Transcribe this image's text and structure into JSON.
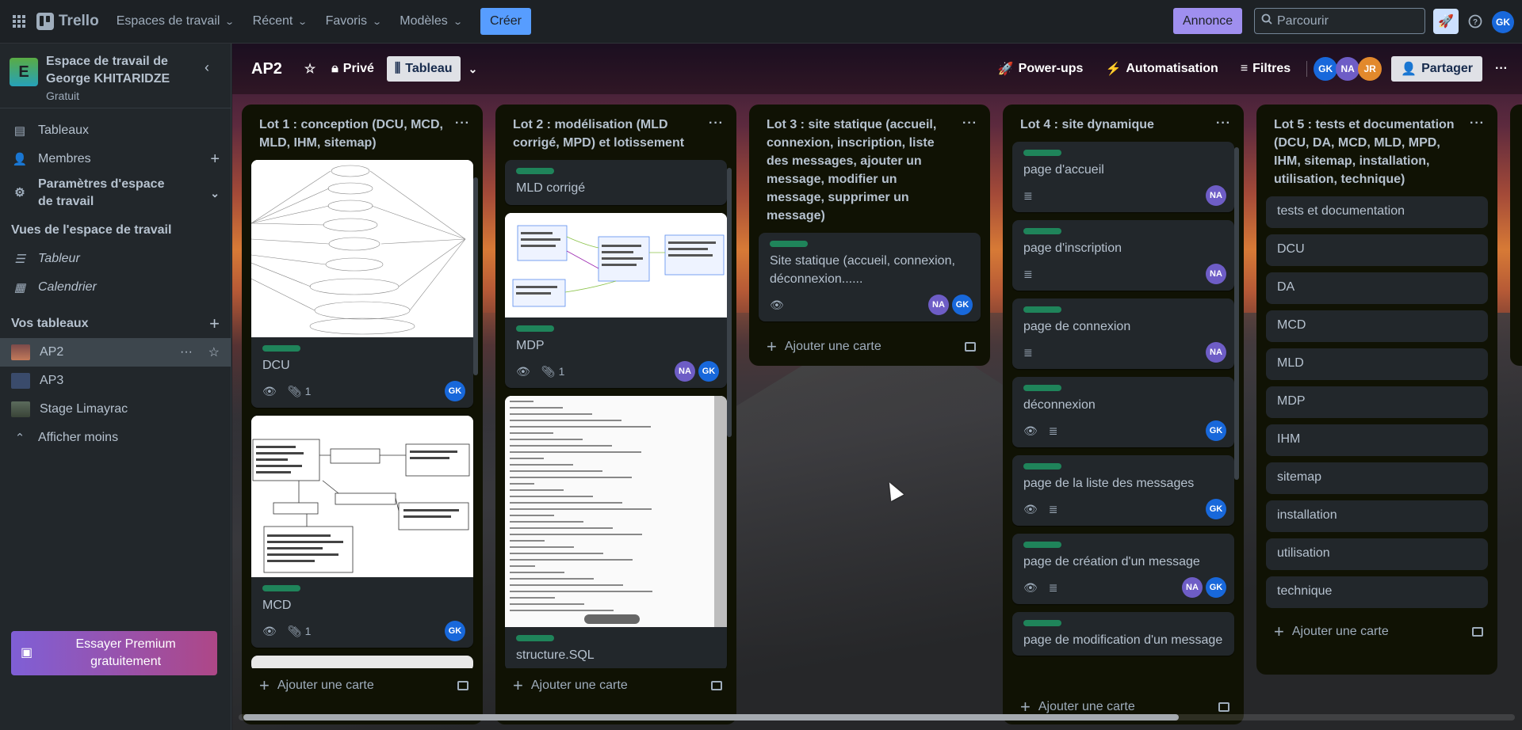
{
  "topbar": {
    "app_name": "Trello",
    "nav": [
      "Espaces de travail",
      "Récent",
      "Favoris",
      "Modèles"
    ],
    "create_label": "Créer",
    "announce_label": "Annonce",
    "search_placeholder": "Parcourir",
    "user_initials": "GK"
  },
  "sidebar": {
    "workspace_initial": "E",
    "workspace_name": "Espace de travail de George KHITARIDZE",
    "workspace_plan": "Gratuit",
    "items": [
      {
        "label": "Tableaux",
        "icon": "trello-board-icon"
      },
      {
        "label": "Membres",
        "icon": "person-icon"
      },
      {
        "label": "Paramètres d'espace de travail",
        "icon": "gear-icon"
      }
    ],
    "views_title": "Vues de l'espace de travail",
    "views": [
      {
        "label": "Tableur",
        "icon": "table-icon"
      },
      {
        "label": "Calendrier",
        "icon": "calendar-icon"
      }
    ],
    "boards_title": "Vos tableaux",
    "boards": [
      {
        "label": "AP2",
        "color": "#a86b5c"
      },
      {
        "label": "AP3",
        "color": "#3a4b6b"
      },
      {
        "label": "Stage Limayrac",
        "color": "#4d5a4f"
      }
    ],
    "show_less": "Afficher moins",
    "premium_label": "Essayer Premium gratuitement"
  },
  "board": {
    "title": "AP2",
    "visibility": "Privé",
    "view": "Tableau",
    "powerups": "Power-ups",
    "automation": "Automatisation",
    "filters": "Filtres",
    "members": [
      "GK",
      "NA",
      "JR"
    ],
    "share": "Partager",
    "add_card": "Ajouter une carte"
  },
  "lists": [
    {
      "title": "Lot 1 : conception (DCU, MCD, MLD, IHM, sitemap)",
      "cards": [
        {
          "title": "DCU",
          "attachments": "1",
          "members": [
            "GK"
          ]
        },
        {
          "title": "MCD",
          "attachments": "1",
          "members": [
            "GK"
          ]
        }
      ]
    },
    {
      "title": "Lot 2 : modélisation (MLD corrigé, MPD) et lotissement",
      "cards": [
        {
          "title": "MLD corrigé"
        },
        {
          "title": "MDP",
          "attachments": "1",
          "members": [
            "NA",
            "GK"
          ]
        },
        {
          "title": "structure.SQL"
        }
      ]
    },
    {
      "title": "Lot 3 : site statique (accueil, connexion, inscription, liste des messages, ajouter un message, modifier un message, supprimer un message)",
      "cards": [
        {
          "title": "Site statique (accueil, connexion, déconnexion......",
          "members": [
            "NA",
            "GK"
          ]
        }
      ]
    },
    {
      "title": "Lot 4 : site dynamique",
      "cards": [
        {
          "title": "page d'accueil",
          "members": [
            "NA"
          ]
        },
        {
          "title": "page d'inscription",
          "members": [
            "NA"
          ]
        },
        {
          "title": "page de connexion",
          "members": [
            "NA"
          ]
        },
        {
          "title": "déconnexion",
          "members": [
            "GK"
          ]
        },
        {
          "title": "page de la liste des messages",
          "members": [
            "GK"
          ]
        },
        {
          "title": "page de création d'un message",
          "members": [
            "NA",
            "GK"
          ]
        },
        {
          "title": "page de modification d'un message"
        }
      ]
    },
    {
      "title": "Lot 5 : tests et documentation (DCU, DA, MCD, MLD, MPD, IHM, sitemap, installation, utilisation, technique)",
      "cards": [
        "tests et documentation",
        "DCU",
        "DA",
        "MCD",
        "MLD",
        "MDP",
        "IHM",
        "sitemap",
        "installation",
        "utilisation",
        "technique"
      ]
    }
  ],
  "colors": {
    "label_green": "#1f845a",
    "accent_blue": "#579dff",
    "announce_purple": "#9f8fef"
  }
}
